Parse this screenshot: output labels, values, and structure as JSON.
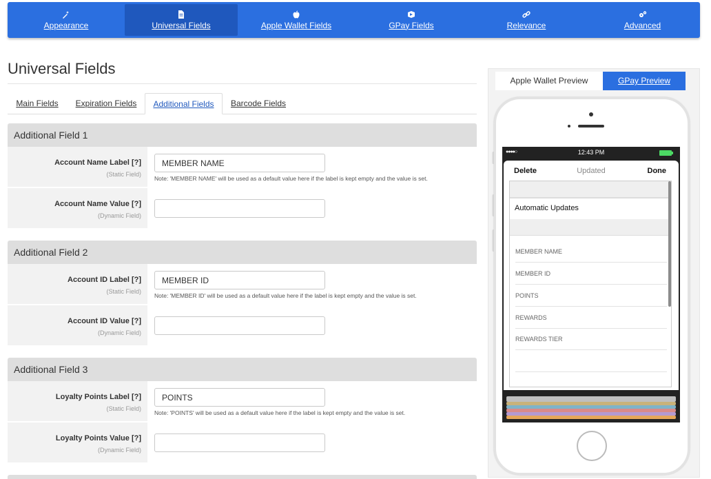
{
  "nav": {
    "items": [
      {
        "label": "Appearance",
        "icon": "magic-wand-icon"
      },
      {
        "label": "Universal Fields",
        "icon": "document-icon"
      },
      {
        "label": "Apple Wallet Fields",
        "icon": "apple-icon"
      },
      {
        "label": "GPay Fields",
        "icon": "gpay-icon"
      },
      {
        "label": "Relevance",
        "icon": "link-icon"
      },
      {
        "label": "Advanced",
        "icon": "gears-icon"
      }
    ],
    "active": "Universal Fields"
  },
  "page": {
    "title": "Universal Fields"
  },
  "subtabs": [
    "Main Fields",
    "Expiration Fields",
    "Additional Fields",
    "Barcode Fields"
  ],
  "sections": [
    {
      "title": "Additional Field 1",
      "label_field": {
        "label": "Account Name Label [?]",
        "sub": "(Static Field)",
        "value": "MEMBER NAME",
        "note": "Note: 'MEMBER NAME' will be used as a default value here if the label is kept empty and the value is set."
      },
      "value_field": {
        "label": "Account Name Value [?]",
        "sub": "(Dynamic Field)",
        "value": ""
      }
    },
    {
      "title": "Additional Field 2",
      "label_field": {
        "label": "Account ID Label [?]",
        "sub": "(Static Field)",
        "value": "MEMBER ID",
        "note": "Note: 'MEMBER ID' will be used as a default value here if the label is kept empty and the value is set."
      },
      "value_field": {
        "label": "Account ID Value [?]",
        "sub": "(Dynamic Field)",
        "value": ""
      }
    },
    {
      "title": "Additional Field 3",
      "label_field": {
        "label": "Loyalty Points Label [?]",
        "sub": "(Static Field)",
        "value": "POINTS",
        "note": "Note: 'POINTS' will be used as a default value here if the label is kept empty and the value is set."
      },
      "value_field": {
        "label": "Loyalty Points Value [?]",
        "sub": "(Dynamic Field)",
        "value": ""
      }
    }
  ],
  "preview": {
    "tabs": {
      "apple": "Apple Wallet Preview",
      "gpay": "GPay Preview"
    },
    "status_time": "12:43 PM",
    "status_dots": "●●●●○",
    "sheet": {
      "delete": "Delete",
      "updated": "Updated",
      "done": "Done"
    },
    "automatic_updates": "Automatic Updates",
    "fields": [
      "MEMBER NAME",
      "MEMBER ID",
      "POINTS",
      "REWARDS",
      "REWARDS TIER"
    ],
    "stack_colors": [
      "#c9b27a",
      "#7fb3c9",
      "#d98a8a",
      "#b49ad1",
      "#e6a65a"
    ]
  }
}
